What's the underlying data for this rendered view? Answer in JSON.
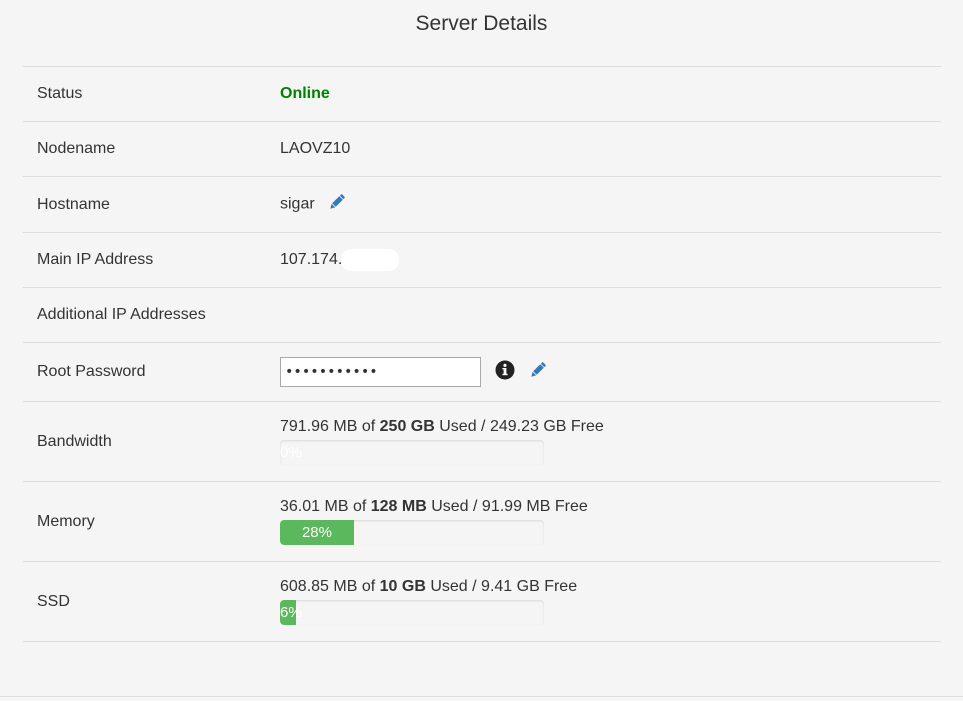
{
  "title": "Server Details",
  "rows": {
    "status": {
      "label": "Status",
      "value": "Online",
      "color": "#008000"
    },
    "nodename": {
      "label": "Nodename",
      "value": "LAOVZ10"
    },
    "hostname": {
      "label": "Hostname",
      "value": "sigar",
      "edit_icon": "pencil-icon"
    },
    "main_ip": {
      "label": "Main IP Address",
      "value": "107.174."
    },
    "additional_ips": {
      "label": "Additional IP Addresses",
      "value": ""
    },
    "root_password": {
      "label": "Root Password",
      "value": "•••••••••••",
      "info_icon": "info-icon",
      "edit_icon": "pencil-icon"
    },
    "bandwidth": {
      "label": "Bandwidth",
      "used": "791.96 MB",
      "of": "of",
      "total": "250 GB",
      "used_word": "Used /",
      "free": "249.23 GB Free",
      "percent": 0,
      "percent_label": "0%"
    },
    "memory": {
      "label": "Memory",
      "used": "36.01 MB",
      "of": "of",
      "total": "128 MB",
      "used_word": "Used /",
      "free": "91.99 MB Free",
      "percent": 28,
      "percent_label": "28%"
    },
    "ssd": {
      "label": "SSD",
      "used": "608.85 MB",
      "of": "of",
      "total": "10 GB",
      "used_word": "Used /",
      "free": "9.41 GB Free",
      "percent": 6,
      "percent_label": "6%"
    }
  },
  "colors": {
    "progress_fill": "#5cb85c",
    "pencil": "#337ab7",
    "background": "#f5f5f5"
  }
}
